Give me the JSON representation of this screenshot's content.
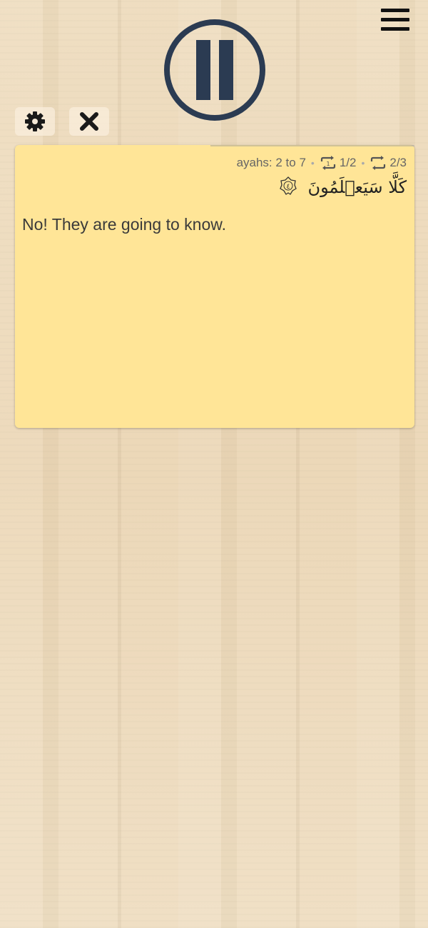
{
  "header": {
    "menu_icon": "hamburger-menu-icon",
    "playback_icon": "pause-icon"
  },
  "toolbar": {
    "settings_icon": "gear-icon",
    "close_icon": "close-icon"
  },
  "card": {
    "background_color": "#ffe597",
    "ayah_range": "ayahs: 2 to 7",
    "repeat_ayah": "1/2",
    "repeat_range": "2/3",
    "arabic_text": "كَلَّا سَيَعۡلَمُونَ",
    "translation": "No! They are going to know."
  },
  "colors": {
    "accent": "#2b3b52",
    "text": "#3a3a3a"
  }
}
